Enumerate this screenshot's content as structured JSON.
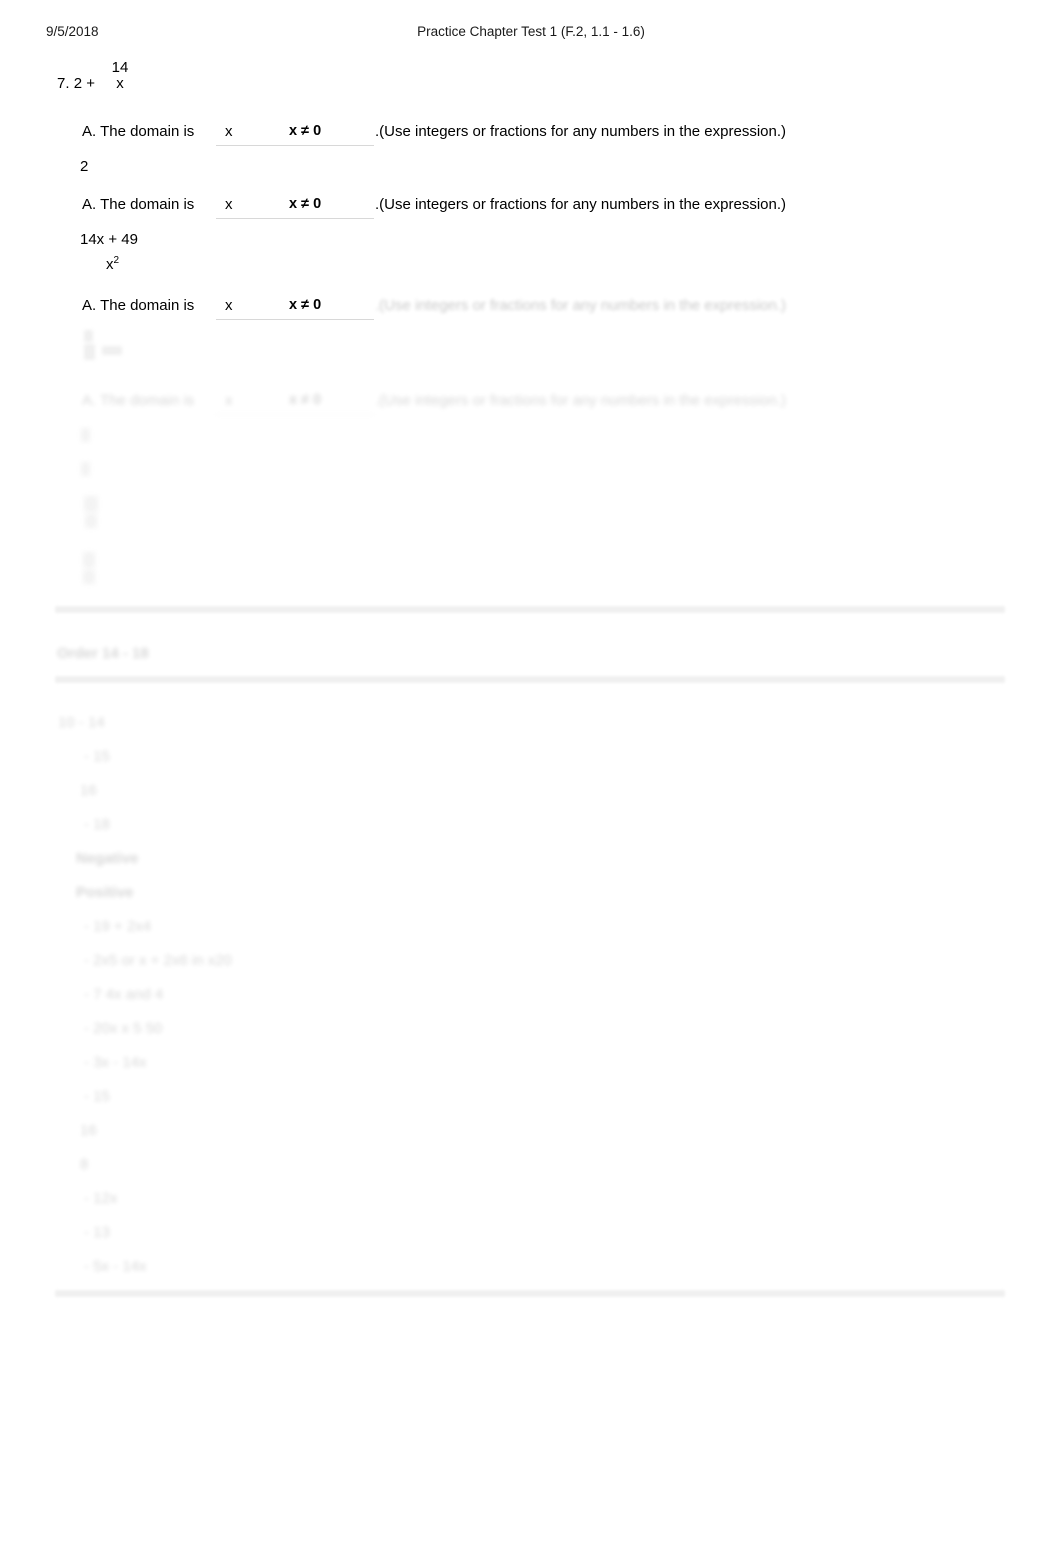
{
  "header": {
    "date": "9/5/2018",
    "title": "Practice Chapter Test 1 (F.2, 1.1 - 1.6)"
  },
  "problem": {
    "number": "7.",
    "lead": "2 +",
    "fraction": {
      "numerator": "14",
      "denominator": "x"
    }
  },
  "answers": [
    {
      "label": "A. The domain is",
      "variable": "x",
      "condition": "x ≠ 0",
      "tail": ".(Use integers or fractions for any numbers in the expression.)",
      "expression": "2"
    },
    {
      "label": "A. The domain is",
      "variable": "x",
      "condition": "x ≠ 0",
      "tail": ".(Use integers or fractions for any numbers in the expression.)",
      "expression_numerator": "14x + 49",
      "expression_denominator": "x",
      "expression_denominator_exponent": "2"
    },
    {
      "label": "A. The domain is",
      "variable": "x",
      "condition": "x ≠ 0",
      "tail": ".(Use integers or fractions for any numbers in the expression.)"
    },
    {
      "label": "A. The domain is",
      "variable": "x",
      "condition": "x ≠ 0",
      "tail": ".(Use integers or fractions for any numbers in the expression.)"
    }
  ],
  "faded_section": {
    "heading": "Order 14 - 18",
    "items": [
      "10 - 14",
      "- 15",
      "16",
      "- 18",
      "Negative",
      "Positive",
      "- 19 + 2x4",
      "- 2x5 or x + 2x6 in x20",
      "- 7 4x and 4",
      "- 20x x 5 50",
      "- 3x - 14x",
      "- 15",
      "16",
      "8",
      "- 12x",
      "- 13",
      "- 5x - 14x"
    ]
  }
}
